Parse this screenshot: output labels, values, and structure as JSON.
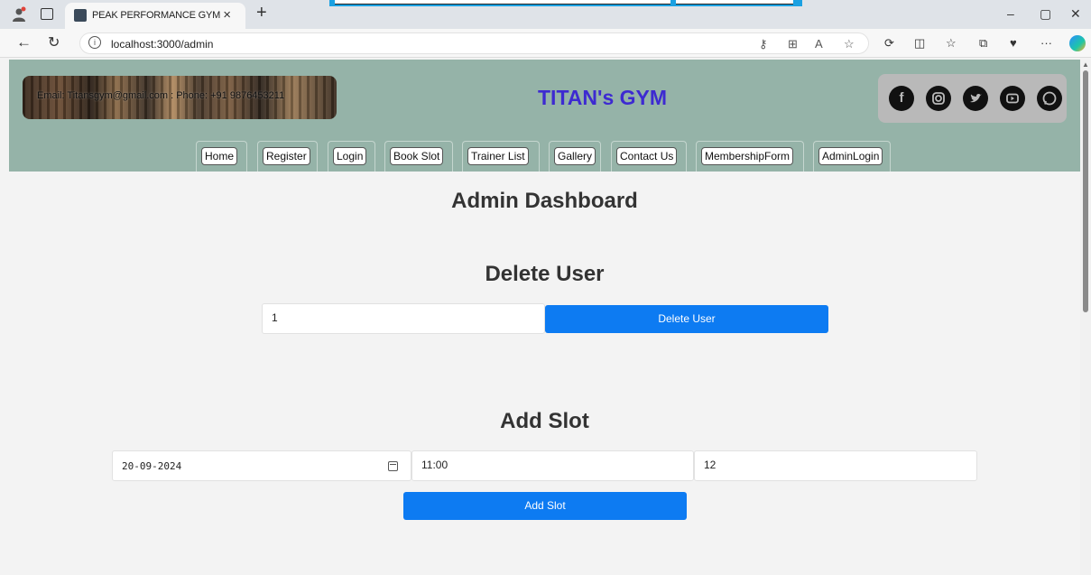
{
  "browser": {
    "tab_title": "PEAK PERFORMANCE GYM",
    "tab_close": "×",
    "new_tab": "+",
    "url": "localhost:3000/admin",
    "window_controls": {
      "minimize": "–",
      "restore": "▢",
      "close": "✕"
    }
  },
  "header": {
    "contact_text": "Email: Titansgym@gmail.com : Phone: +91 9876453211",
    "site_title": "TITAN's GYM",
    "social_icons": [
      "facebook-icon",
      "instagram-icon",
      "twitter-icon",
      "youtube-icon",
      "whatsapp-icon"
    ]
  },
  "nav": {
    "items": [
      {
        "label": "Home"
      },
      {
        "label": "Register"
      },
      {
        "label": "Login"
      },
      {
        "label": "Book Slot"
      },
      {
        "label": "Trainer List"
      },
      {
        "label": "Gallery"
      },
      {
        "label": "Contact Us"
      },
      {
        "label": "MembershipForm"
      },
      {
        "label": "AdminLogin"
      }
    ]
  },
  "dashboard": {
    "title": "Admin Dashboard",
    "delete_user": {
      "heading": "Delete User",
      "user_id_value": "1",
      "button_label": "Delete User"
    },
    "add_slot": {
      "heading": "Add Slot",
      "date_value": "20-09-2024",
      "time_value": "11:00",
      "capacity_value": "12",
      "button_label": "Add Slot"
    }
  },
  "colors": {
    "header_bg": "#95b3a8",
    "title": "#3d2ad1",
    "primary_button": "#0d7bf2",
    "page_bg": "#f3f3f3"
  }
}
